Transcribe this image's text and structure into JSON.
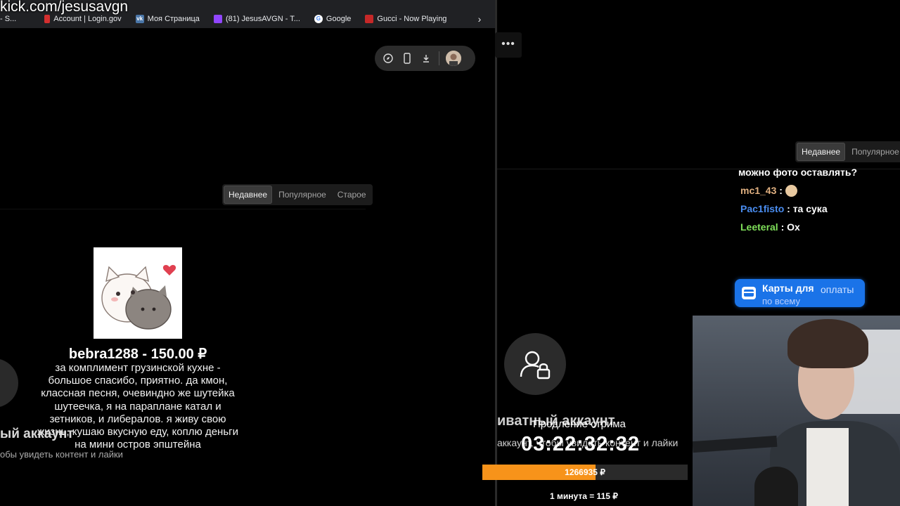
{
  "browser": {
    "url_overlay": "kick.com/jesusavgn",
    "bookmarks": [
      {
        "label": "- S...",
        "icon": "dot-icon",
        "color": "#888888"
      },
      {
        "label": "Account | Login.gov",
        "icon": "login-gov-icon",
        "color": "#d32f2f"
      },
      {
        "label": "Моя Страница",
        "icon": "vk-icon",
        "color": "#4a76a8"
      },
      {
        "label": "(81) JesusAVGN - T...",
        "icon": "twitch-icon",
        "color": "#9146ff"
      },
      {
        "label": "Google",
        "icon": "google-icon",
        "color": "#4285f4"
      },
      {
        "label": "Gucci - Now Playing",
        "icon": "gucci-icon",
        "color": "#c62828"
      }
    ],
    "bookmarks_more": "›"
  },
  "left_feed": {
    "sort_tabs": [
      "Недавнее",
      "Популярное",
      "Старое"
    ],
    "donation": {
      "title": "bebra1288 - 150.00 ₽",
      "message": "за комплимент грузинской кухне - большое спасибо, приятно. да кмон, классная песня, очевиндно же шутейка шутеечка, я на параплане катал и зетников, и либералов. я живу свою жизнь, кушаю вкусную еду, коплю деньги на мини остров эпштейна"
    },
    "private_title": "ый аккаунт",
    "private_sub": "обы увидеть контент и лайки"
  },
  "right_panel": {
    "kebab": "•••",
    "sort_tabs": [
      "Недавнее",
      "Популярное"
    ],
    "chat": [
      {
        "user": "",
        "text": "можно фото оставлять?",
        "color": "#ffffff"
      },
      {
        "user": "mc1_43",
        "text": "",
        "color": "#e0b080",
        "emote": "burger-emote"
      },
      {
        "user": "Pac1fisto",
        "text": "та сука",
        "color": "#4a8df0"
      },
      {
        "user": "Leeteral",
        "text": "Ох",
        "color": "#7fe05a"
      }
    ],
    "payment_banner": {
      "title": "Карты для",
      "title_b": "оплаты",
      "sub": "по всему"
    },
    "private_title": "иватный аккаунт",
    "private_sub": "аккаунт, чтобы увидеть контент и лайки",
    "subathon": {
      "label": "Продление стрима",
      "timer": "03:22:32:32",
      "amount": "1266935 ₽",
      "progress": 0.55,
      "rate": "1 минута = 115 ₽"
    }
  },
  "colors": {
    "accent_orange": "#f7931a",
    "banner_blue": "#1a73e8"
  }
}
